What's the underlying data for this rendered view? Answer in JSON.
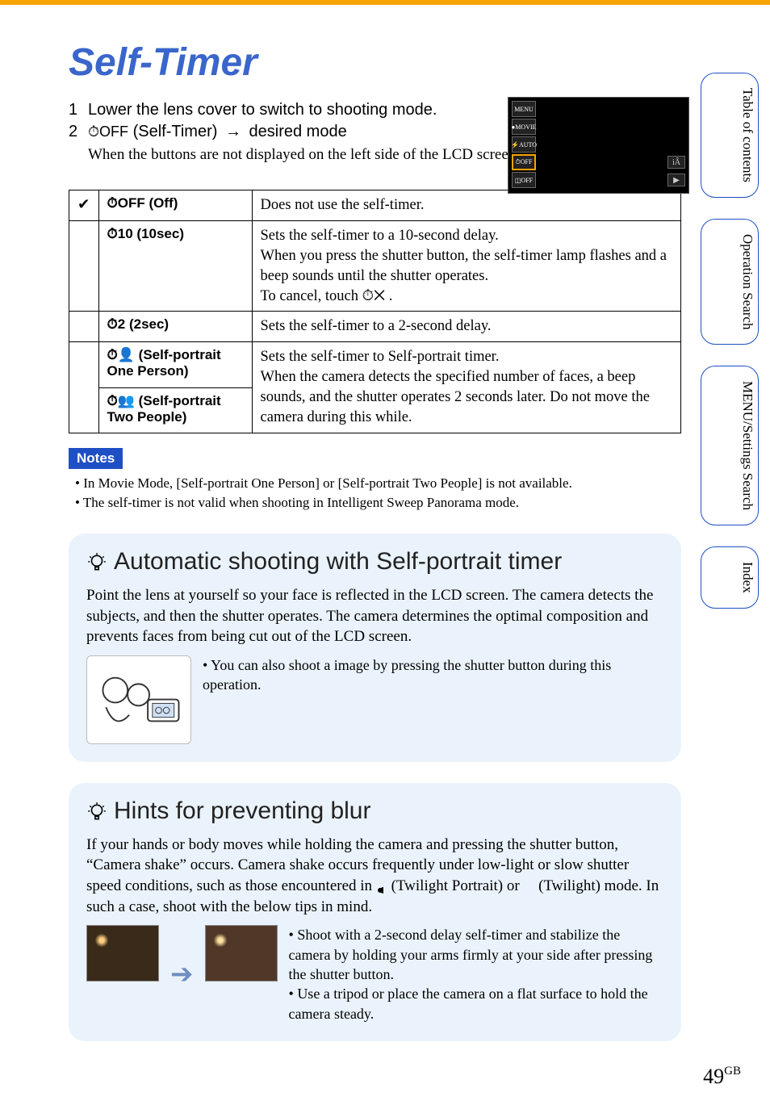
{
  "title": "Self-Timer",
  "steps": {
    "s1_num": "1",
    "s1_text": "Lower the lens cover to switch to shooting mode.",
    "s2_num": "2",
    "s2_prefix": "",
    "s2_mode_label": " (Self-Timer) ",
    "s2_suffix": " desired mode",
    "s2_note_a": "When the buttons are not displayed on the left side of the LCD screen, touch ",
    "s2_note_b": ".",
    "menu_label": "MENU",
    "timer_off_glyph": "⏱OFF"
  },
  "table": {
    "check": "✔",
    "rows": [
      {
        "name": "⏱OFF (Off)",
        "desc": "Does not use the self-timer."
      },
      {
        "name": "⏱10 (10sec)",
        "desc": "Sets the self-timer to a 10-second delay.\nWhen you press the shutter button, the self-timer lamp flashes and a beep sounds until the shutter operates.\nTo cancel, touch ⏱✕ ."
      },
      {
        "name": "⏱2 (2sec)",
        "desc": "Sets the self-timer to a 2-second delay."
      },
      {
        "name": "⏱👤 (Self-portrait One Person)",
        "desc_joined_top": "Sets the self-timer to Self-portrait timer.\nWhen the camera detects the specified number of faces, a beep sounds, and the shutter operates 2 seconds later. Do not move the camera during this while."
      },
      {
        "name": "⏱👥 (Self-portrait Two People)"
      }
    ]
  },
  "notes": {
    "label": "Notes",
    "items": [
      "In Movie Mode, [Self-portrait One Person] or [Self-portrait Two People] is not available.",
      "The self-timer is not valid when shooting in Intelligent Sweep Panorama mode."
    ]
  },
  "tips": {
    "auto": {
      "title": "Automatic shooting with Self-portrait timer",
      "body": "Point the lens at yourself so your face is reflected in the LCD screen. The camera detects the subjects, and then the shutter operates. The camera determines the optimal composition and prevents faces from being cut out of the LCD screen.",
      "bullet": "You can also shoot a image by pressing the shutter button during this operation."
    },
    "blur": {
      "title": "Hints for preventing blur",
      "body_a": "If your hands or body moves while holding the camera and pressing the shutter button, “Camera shake” occurs. Camera shake occurs frequently under low-light or slow shutter speed conditions, such as those encountered in ",
      "body_b": " (Twilight Portrait) or ",
      "body_c": " (Twilight) mode. In such a case, shoot with the below tips in mind.",
      "bullets": [
        "Shoot with a 2-second delay self-timer and stabilize the camera by holding your arms firmly at your side after pressing the shutter button.",
        "Use a tripod or place the camera on a flat surface to hold the camera steady."
      ]
    }
  },
  "sidetabs": [
    "Table of contents",
    "Operation Search",
    "MENU/Settings Search",
    "Index"
  ],
  "page_number": "49",
  "page_suffix": "GB",
  "screenshot_btns": [
    "MENU",
    "●MOVIE",
    "⚡AUTO",
    "⏱OFF",
    "◫OFF"
  ]
}
